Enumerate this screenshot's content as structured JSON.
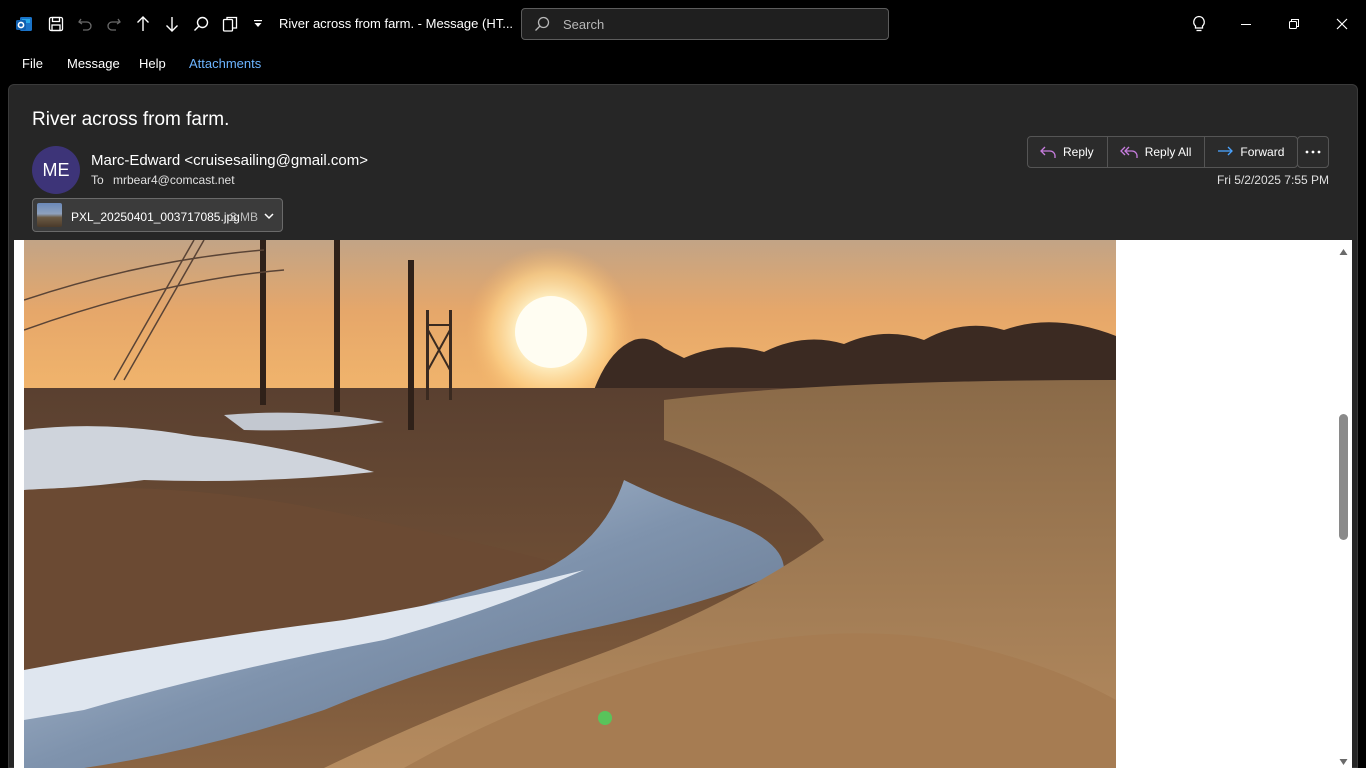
{
  "window": {
    "title": "River across from farm.  -  Message (HT...",
    "search_placeholder": "Search",
    "app_icon": "outlook-icon"
  },
  "menu": {
    "items": [
      "File",
      "Message",
      "Help",
      "Attachments"
    ],
    "active": "Attachments"
  },
  "message": {
    "subject": "River across from farm.",
    "avatar_initials": "ME",
    "sender": "Marc-Edward <cruisesailing@gmail.com>",
    "to_label": "To",
    "to": "mrbear4@comcast.net",
    "date": "Fri 5/2/2025 7:55 PM",
    "actions": {
      "reply": "Reply",
      "reply_all": "Reply All",
      "forward": "Forward"
    },
    "attachment": {
      "filename": "PXL_20250401_003717085.jpg",
      "size": "3 MB"
    }
  },
  "colors": {
    "avatar_bg": "#3d3478",
    "accent": "#6cb4ff",
    "reply_icon": "#c77dde",
    "forward_icon": "#4aa3ff"
  }
}
